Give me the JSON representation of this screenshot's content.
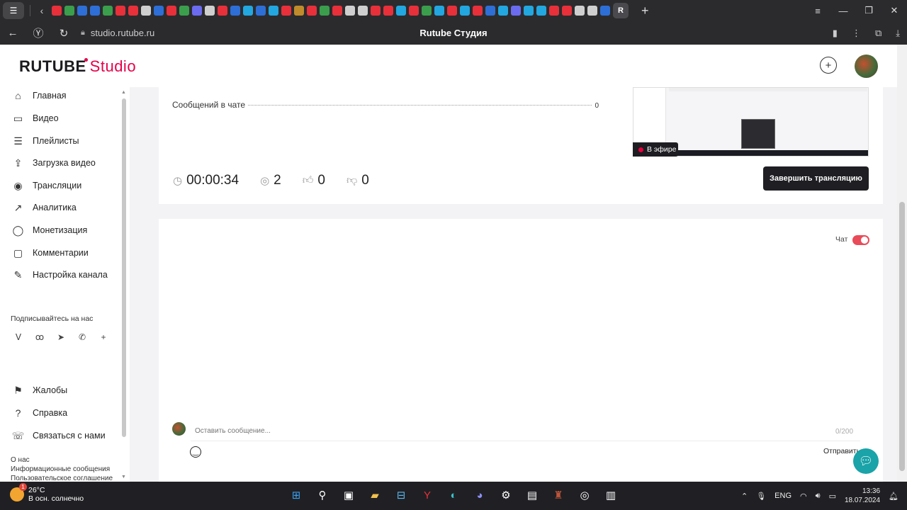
{
  "browser": {
    "home_icon": "yandex-menu-icon",
    "url": "studio.rutube.ru",
    "page_title": "Rutube Студия",
    "active_tab_glyph": "R",
    "tab_colors": [
      "#e8303a",
      "#3a9e4c",
      "#2d6fd6",
      "#2d6fd6",
      "#3a9e4c",
      "#e8303a",
      "#e8303a",
      "#cfcfcf",
      "#2d6fd6",
      "#e8303a",
      "#3a9e4c",
      "#6b6bf0",
      "#cfcfcf",
      "#e8303a",
      "#2d6fd6",
      "#22a7e0",
      "#2d6fd6",
      "#22a7e0",
      "#e8303a",
      "#c08b2b",
      "#e8303a",
      "#3a9e4c",
      "#e8303a",
      "#cfcfcf",
      "#cfcfcf",
      "#e8303a",
      "#e8303a",
      "#22a7e0",
      "#e8303a",
      "#3a9e4c",
      "#22a7e0",
      "#e8303a",
      "#22a7e0",
      "#e8303a",
      "#2d6fd6",
      "#22a7e0",
      "#6b6bf0",
      "#22a7e0",
      "#22a7e0",
      "#e8303a",
      "#e8303a",
      "#cfcfcf",
      "#cfcfcf",
      "#2d6fd6"
    ]
  },
  "header": {
    "logo_main": "RUTUBE",
    "logo_sub": "Studio"
  },
  "sidebar": {
    "items": [
      {
        "label": "Главная",
        "icon": "home-icon",
        "glyph": "⌂"
      },
      {
        "label": "Видео",
        "icon": "video-icon",
        "glyph": "▭"
      },
      {
        "label": "Плейлисты",
        "icon": "playlist-icon",
        "glyph": "☰"
      },
      {
        "label": "Загрузка видео",
        "icon": "upload-icon",
        "glyph": "⇪"
      },
      {
        "label": "Трансляции",
        "icon": "broadcast-icon",
        "glyph": "◉"
      },
      {
        "label": "Аналитика",
        "icon": "analytics-icon",
        "glyph": "↗"
      },
      {
        "label": "Монетизация",
        "icon": "monetization-icon",
        "glyph": "◯"
      },
      {
        "label": "Комментарии",
        "icon": "comments-icon",
        "glyph": "▢"
      },
      {
        "label": "Настройка канала",
        "icon": "settings-icon",
        "glyph": "✎"
      }
    ],
    "follow_label": "Подписывайтесь на нас",
    "socials": [
      "vk",
      "ok",
      "telegram",
      "viber",
      "more"
    ],
    "bottom_items": [
      {
        "label": "Жалобы",
        "glyph": "⚑"
      },
      {
        "label": "Справка",
        "glyph": "?"
      },
      {
        "label": "Связаться с нами",
        "glyph": "☏"
      }
    ],
    "footer_links": [
      "О нас",
      "Информационные сообщения",
      "Пользовательское соглашение"
    ]
  },
  "stream": {
    "chat_messages_label": "Сообщений в чате",
    "chat_messages_value": "0",
    "live_badge": "В эфире",
    "duration": "00:00:34",
    "viewers": "2",
    "likes": "0",
    "dislikes": "0",
    "end_button": "Завершить трансляцию"
  },
  "chat": {
    "toggle_label": "Чат",
    "toggle_on": true,
    "input_placeholder": "Оставить сообщение...",
    "counter": "0/200",
    "send_label": "Отправить"
  },
  "taskbar": {
    "temperature": "26°C",
    "weather": "В осн. солнечно",
    "weather_badge": "1",
    "language": "ENG",
    "time": "13:36",
    "date": "18.07.2024"
  }
}
